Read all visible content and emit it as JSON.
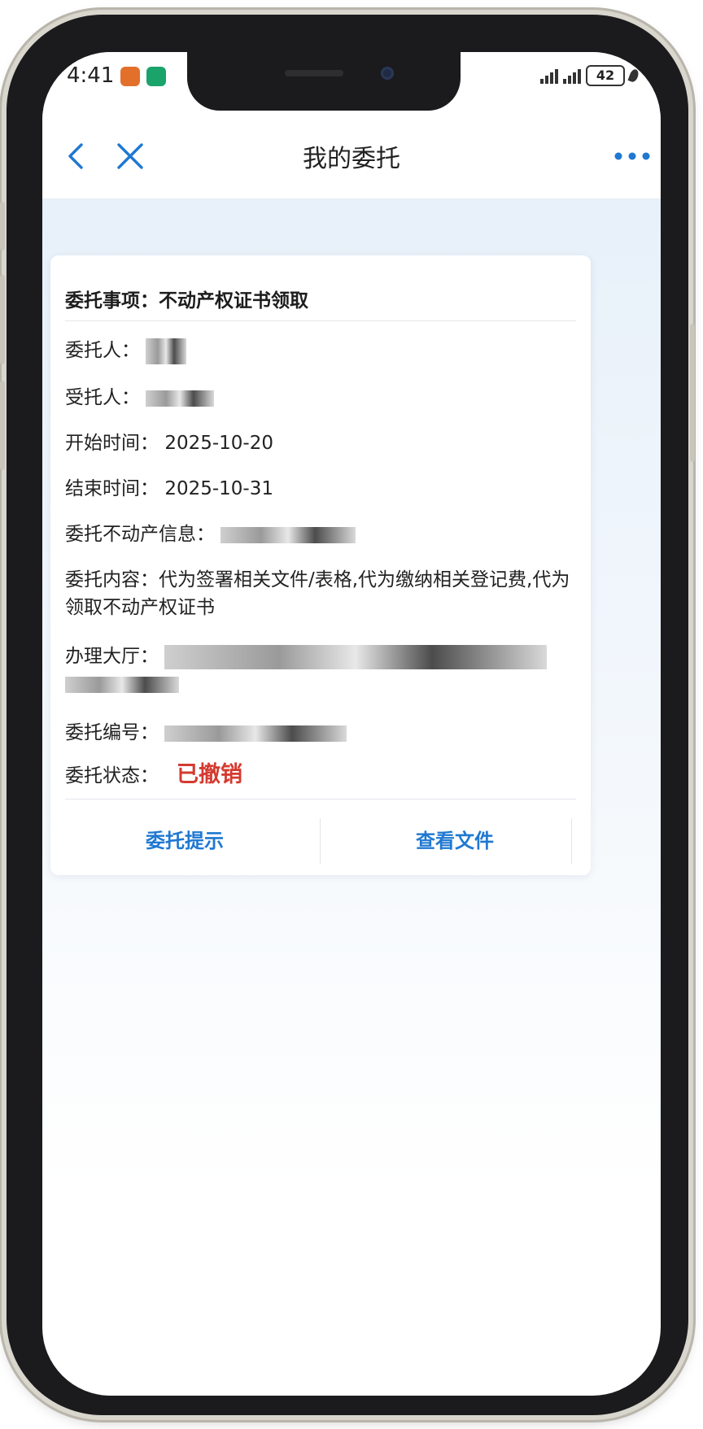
{
  "status_bar": {
    "time": "4:41",
    "battery": "42"
  },
  "nav": {
    "title": "我的委托"
  },
  "card": {
    "title": "委托事项：不动产权证书领取",
    "rows": {
      "client_label": "委托人：",
      "agent_label": "受托人：",
      "start_label": "开始时间：",
      "start_value": "2025-10-20",
      "end_label": "结束时间：",
      "end_value": "2025-10-31",
      "property_label": "委托不动产信息：",
      "content_label": "委托内容：",
      "content_value": "代为签署相关文件/表格,代为缴纳相关登记费,代为领取不动产权证书",
      "hall_label": "办理大厅：",
      "number_label": "委托编号：",
      "status_label": "委托状态：",
      "status_value": "已撤销"
    },
    "actions": {
      "hint": "委托提示",
      "view_files": "查看文件"
    }
  },
  "colors": {
    "accent": "#1f78d1",
    "status_revoked": "#d43a30"
  }
}
